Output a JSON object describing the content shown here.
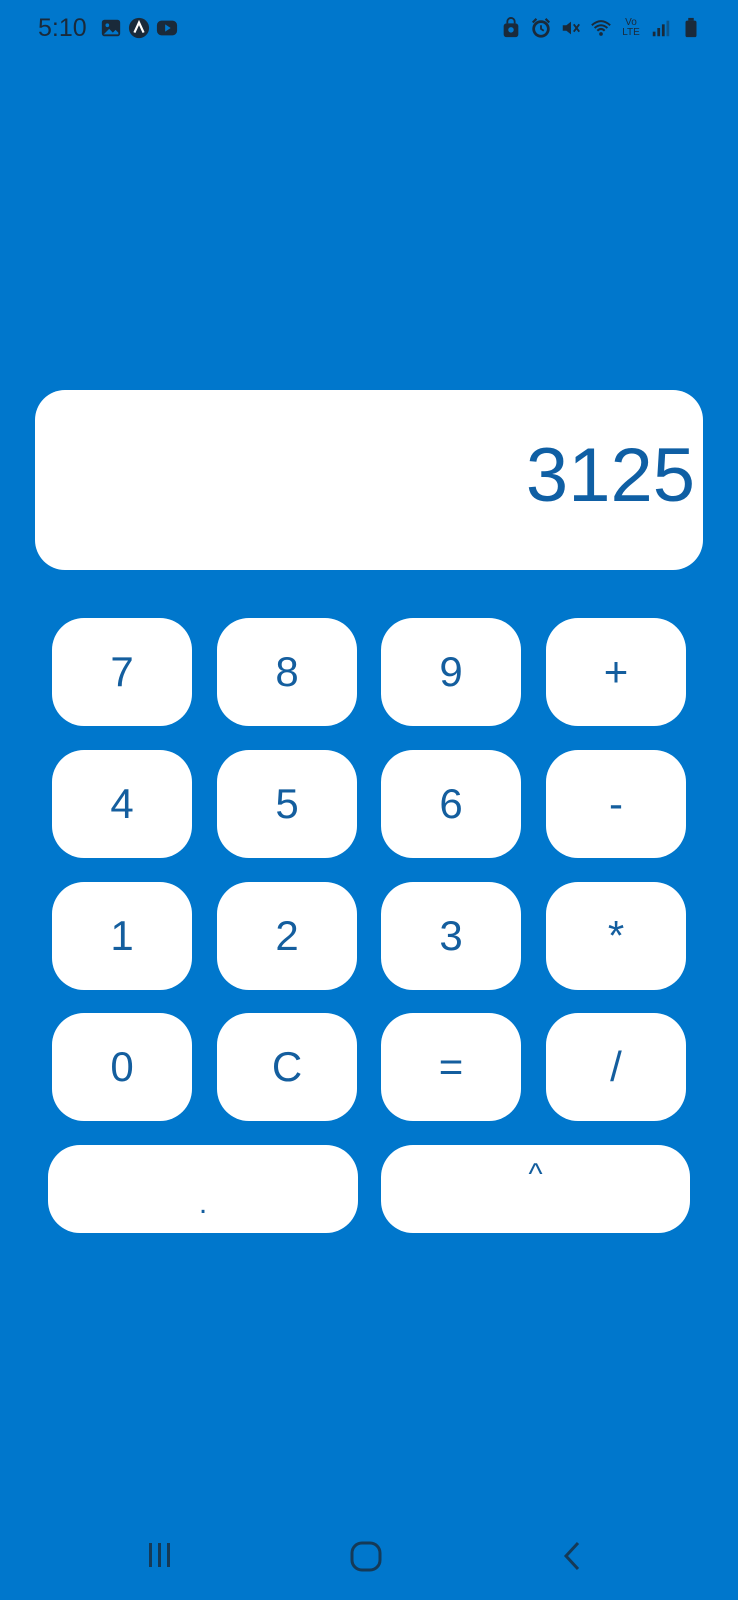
{
  "status_bar": {
    "time": "5:10",
    "left_icons": [
      "gallery-icon",
      "app-a-icon",
      "youtube-icon"
    ],
    "right_icons": [
      "lock-screen-icon",
      "alarm-icon",
      "mute-icon",
      "wifi-icon",
      "volte-icon",
      "signal-icon",
      "battery-icon"
    ],
    "volte_text": "Vo LTE"
  },
  "display": {
    "value": "3125"
  },
  "keys": {
    "k7": "7",
    "k8": "8",
    "k9": "9",
    "kplus": "+",
    "k4": "4",
    "k5": "5",
    "k6": "6",
    "kminus": "-",
    "k1": "1",
    "k2": "2",
    "k3": "3",
    "kmul": "*",
    "k0": "0",
    "kc": "C",
    "keq": "=",
    "kdiv": "/",
    "kdot": ".",
    "kpow": "^"
  },
  "colors": {
    "background": "#0077CC",
    "key_bg": "#FFFFFF",
    "key_text": "#145E9E"
  }
}
